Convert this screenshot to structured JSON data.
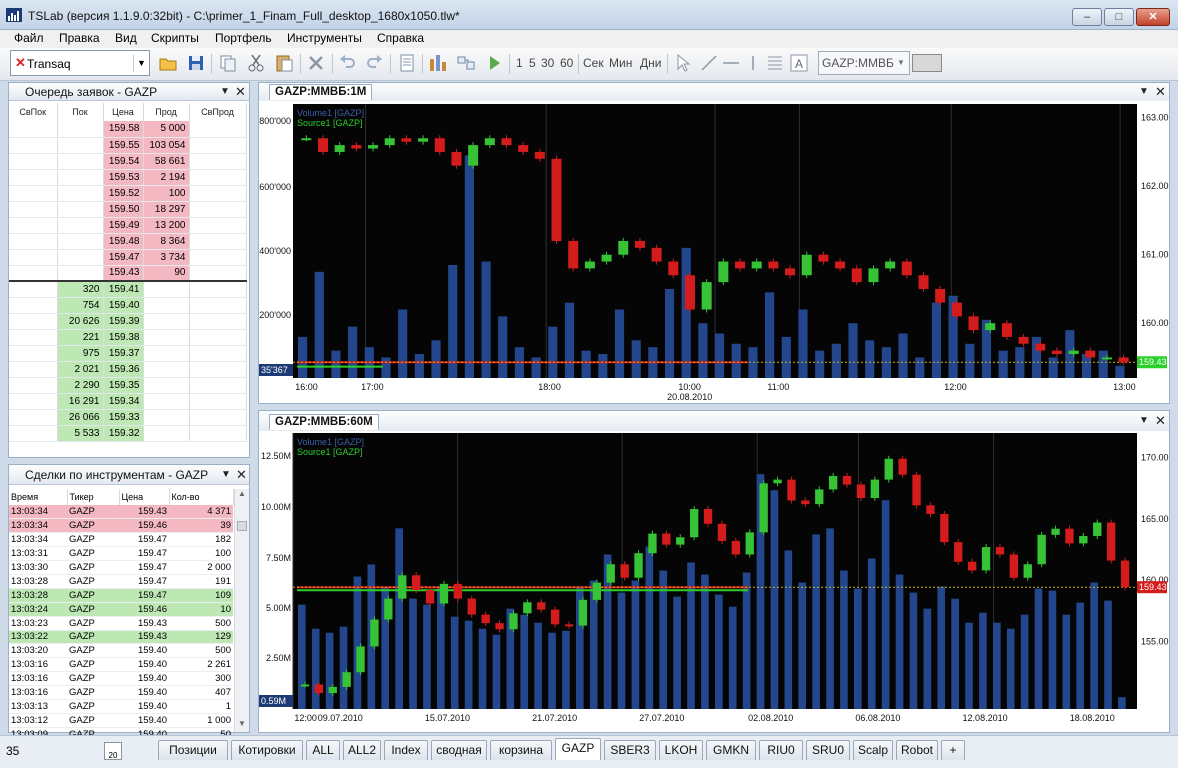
{
  "window": {
    "title": "TSLab (версия 1.1.9.0:32bit) - C:\\primer_1_Finam_Full_desktop_1680x1050.tlw*",
    "controls": {
      "minimize": "–",
      "maximize": "□",
      "close": "✕"
    }
  },
  "menu": [
    "Файл",
    "Правка",
    "Вид",
    "Скрипты",
    "Портфель",
    "Инструменты",
    "Справка"
  ],
  "toolbar": {
    "broker": "Transaq",
    "intervals": [
      "1",
      "5",
      "30",
      "60"
    ],
    "units": [
      "Сек",
      "Мин",
      "Дни"
    ],
    "symbol_combo": "GAZP:ММВБ",
    "icons": [
      "open-folder-icon",
      "save-icon",
      "copy-icon",
      "cut-icon",
      "paste-icon",
      "delete-icon",
      "undo-icon",
      "redo-icon",
      "properties-icon",
      "chart-bars-icon",
      "layout-icon",
      "play-icon",
      "cursor-icon",
      "line-icon",
      "hline-icon",
      "vline-icon",
      "fib-icon",
      "text-icon"
    ]
  },
  "orderbook": {
    "title": "Очередь заявок - GAZP",
    "columns": [
      "СвПок",
      "Пок",
      "Цена",
      "Прод",
      "СвПрод"
    ],
    "asks": [
      {
        "price": "159.58",
        "qty": "5 000"
      },
      {
        "price": "159.55",
        "qty": "103 054"
      },
      {
        "price": "159.54",
        "qty": "58 661"
      },
      {
        "price": "159.53",
        "qty": "2 194"
      },
      {
        "price": "159.52",
        "qty": "100"
      },
      {
        "price": "159.50",
        "qty": "18 297"
      },
      {
        "price": "159.49",
        "qty": "13 200"
      },
      {
        "price": "159.48",
        "qty": "8 364"
      },
      {
        "price": "159.47",
        "qty": "3 734"
      },
      {
        "price": "159.43",
        "qty": "90"
      }
    ],
    "bids": [
      {
        "price": "159.41",
        "qty": "320"
      },
      {
        "price": "159.40",
        "qty": "754"
      },
      {
        "price": "159.39",
        "qty": "20 626"
      },
      {
        "price": "159.38",
        "qty": "221"
      },
      {
        "price": "159.37",
        "qty": "975"
      },
      {
        "price": "159.36",
        "qty": "2 021"
      },
      {
        "price": "159.35",
        "qty": "2 290"
      },
      {
        "price": "159.34",
        "qty": "16 291"
      },
      {
        "price": "159.33",
        "qty": "26 066"
      },
      {
        "price": "159.32",
        "qty": "5 533"
      }
    ]
  },
  "trades": {
    "title": "Сделки по инструментам - GAZP",
    "columns": [
      "Время",
      "Тикер",
      "Цена",
      "Кол-во"
    ],
    "rows": [
      {
        "time": "13:03:34",
        "ticker": "GAZP",
        "price": "159.43",
        "qty": "4 371",
        "side": "sell"
      },
      {
        "time": "13:03:34",
        "ticker": "GAZP",
        "price": "159.46",
        "qty": "39",
        "side": "sell"
      },
      {
        "time": "13:03:34",
        "ticker": "GAZP",
        "price": "159.47",
        "qty": "182",
        "side": ""
      },
      {
        "time": "13:03:31",
        "ticker": "GAZP",
        "price": "159.47",
        "qty": "100",
        "side": ""
      },
      {
        "time": "13:03:30",
        "ticker": "GAZP",
        "price": "159.47",
        "qty": "2 000",
        "side": ""
      },
      {
        "time": "13:03:28",
        "ticker": "GAZP",
        "price": "159.47",
        "qty": "191",
        "side": ""
      },
      {
        "time": "13:03:28",
        "ticker": "GAZP",
        "price": "159.47",
        "qty": "109",
        "side": "buy"
      },
      {
        "time": "13:03:24",
        "ticker": "GAZP",
        "price": "159.46",
        "qty": "10",
        "side": "buy"
      },
      {
        "time": "13:03:23",
        "ticker": "GAZP",
        "price": "159.43",
        "qty": "500",
        "side": ""
      },
      {
        "time": "13:03:22",
        "ticker": "GAZP",
        "price": "159.43",
        "qty": "129",
        "side": "buy"
      },
      {
        "time": "13:03:20",
        "ticker": "GAZP",
        "price": "159.40",
        "qty": "500",
        "side": ""
      },
      {
        "time": "13:03:16",
        "ticker": "GAZP",
        "price": "159.40",
        "qty": "2 261",
        "side": ""
      },
      {
        "time": "13:03:16",
        "ticker": "GAZP",
        "price": "159.40",
        "qty": "300",
        "side": ""
      },
      {
        "time": "13:03:16",
        "ticker": "GAZP",
        "price": "159.40",
        "qty": "407",
        "side": ""
      },
      {
        "time": "13:03:13",
        "ticker": "GAZP",
        "price": "159.40",
        "qty": "1",
        "side": ""
      },
      {
        "time": "13:03:12",
        "ticker": "GAZP",
        "price": "159.40",
        "qty": "1 000",
        "side": ""
      },
      {
        "time": "13:03:09",
        "ticker": "GAZP",
        "price": "159.40",
        "qty": "50",
        "side": ""
      }
    ]
  },
  "chart_data": [
    {
      "type": "line",
      "tab": "GAZP:ММВБ:1М",
      "legend": [
        "Volume1 [GAZP]",
        "Source1 [GAZP]"
      ],
      "price_axis": {
        "ticks": [
          "163.00",
          "162.00",
          "161.00",
          "160.00"
        ],
        "ylim": [
          159.2,
          163.2
        ],
        "last": "159.43"
      },
      "volume_axis": {
        "ticks": [
          "800'000",
          "600'000",
          "400'000",
          "200'000"
        ],
        "ylim": [
          0,
          800000
        ],
        "last": "35'367"
      },
      "x_labels": [
        "16:00",
        "17:00",
        "18:00",
        "10:00",
        "11:00",
        "12:00",
        "13:00"
      ],
      "date_label": "20.08.2010",
      "source": [
        162.7,
        162.5,
        162.6,
        162.55,
        162.6,
        162.7,
        162.65,
        162.7,
        162.5,
        162.3,
        162.6,
        162.7,
        162.6,
        162.5,
        162.4,
        161.2,
        160.8,
        160.9,
        161.0,
        161.2,
        161.1,
        160.9,
        160.7,
        160.2,
        160.6,
        160.9,
        160.8,
        160.9,
        160.8,
        160.7,
        161.0,
        160.9,
        160.8,
        160.6,
        160.8,
        160.9,
        160.7,
        160.5,
        160.3,
        160.1,
        159.9,
        160.0,
        159.8,
        159.7,
        159.6,
        159.55,
        159.6,
        159.5,
        159.5,
        159.43
      ],
      "volume": [
        120000,
        310000,
        80000,
        150000,
        90000,
        60000,
        200000,
        70000,
        110000,
        330000,
        650000,
        340000,
        180000,
        90000,
        60000,
        150000,
        220000,
        80000,
        70000,
        200000,
        110000,
        90000,
        260000,
        380000,
        160000,
        130000,
        100000,
        90000,
        250000,
        120000,
        200000,
        80000,
        100000,
        160000,
        110000,
        90000,
        130000,
        60000,
        220000,
        240000,
        100000,
        170000,
        80000,
        90000,
        120000,
        60000,
        140000,
        70000,
        80000,
        35367
      ],
      "levels": {
        "bid": 159.41,
        "ask": 159.43
      }
    },
    {
      "type": "line",
      "tab": "GAZP:ММВБ:60М",
      "legend": [
        "Volume1 [GAZP]",
        "Source1 [GAZP]"
      ],
      "price_axis": {
        "ticks": [
          "170.00",
          "165.00",
          "160.00",
          "155.00"
        ],
        "ylim": [
          149.5,
          172
        ],
        "last": "159.43"
      },
      "volume_axis": {
        "ticks": [
          "12.50M",
          "10.00M",
          "7.50M",
          "5.00M",
          "2.50M"
        ],
        "ylim": [
          0,
          13750000
        ],
        "last": "0.59M"
      },
      "x_labels": [
        "12:00",
        "09.07.2010",
        "15.07.2010",
        "21.07.2010",
        "27.07.2010",
        "02.08.2010",
        "06.08.2010",
        "12.08.2010",
        "18.08.2010"
      ],
      "source": [
        151.5,
        150.8,
        151.3,
        152.5,
        154.6,
        156.8,
        158.5,
        160.4,
        159.2,
        158.1,
        159.7,
        158.5,
        157.2,
        156.5,
        156.0,
        157.3,
        158.2,
        157.6,
        156.4,
        156.3,
        158.4,
        159.8,
        161.3,
        160.2,
        162.2,
        163.8,
        162.9,
        163.5,
        165.8,
        164.6,
        163.2,
        162.1,
        163.9,
        167.9,
        168.2,
        166.5,
        166.2,
        167.4,
        168.5,
        167.8,
        166.7,
        168.2,
        169.9,
        168.6,
        166.1,
        165.4,
        163.1,
        161.5,
        160.8,
        162.7,
        162.1,
        160.2,
        161.3,
        163.7,
        164.2,
        163.0,
        163.6,
        164.7,
        161.6,
        159.43
      ],
      "volume": [
        5200000,
        4000000,
        3800000,
        4100000,
        6600000,
        7200000,
        6100000,
        9000000,
        5500000,
        5200000,
        6100000,
        4600000,
        4400000,
        4000000,
        3700000,
        5000000,
        4700000,
        4300000,
        3800000,
        3900000,
        6100000,
        6400000,
        7700000,
        5800000,
        6400000,
        8100000,
        6900000,
        5600000,
        7300000,
        6700000,
        5700000,
        5100000,
        6800000,
        11700000,
        10900000,
        7900000,
        6300000,
        8700000,
        9000000,
        6900000,
        6000000,
        7500000,
        10400000,
        6700000,
        5800000,
        5000000,
        6100000,
        5500000,
        4300000,
        4800000,
        4300000,
        4000000,
        4700000,
        6000000,
        5900000,
        4700000,
        5300000,
        6300000,
        5400000,
        590000
      ],
      "levels": {
        "bid": 159.43,
        "ask": 159.43
      }
    }
  ],
  "colors": {
    "up": "#36c436",
    "down": "#d41c1c",
    "volume": "#23468c",
    "chart_bg": "#050505"
  },
  "statusbar": {
    "value": "35",
    "icon_label": "20"
  },
  "tabs": [
    "Позиции",
    "Котировки",
    "ALL",
    "ALL2",
    "Index",
    "сводная",
    "корзина",
    "GAZP",
    "SBER3",
    "LKOH",
    "GMKN",
    "RIU0",
    "SRU0",
    "Scalp",
    "Robot",
    "+"
  ],
  "active_tab": "GAZP"
}
